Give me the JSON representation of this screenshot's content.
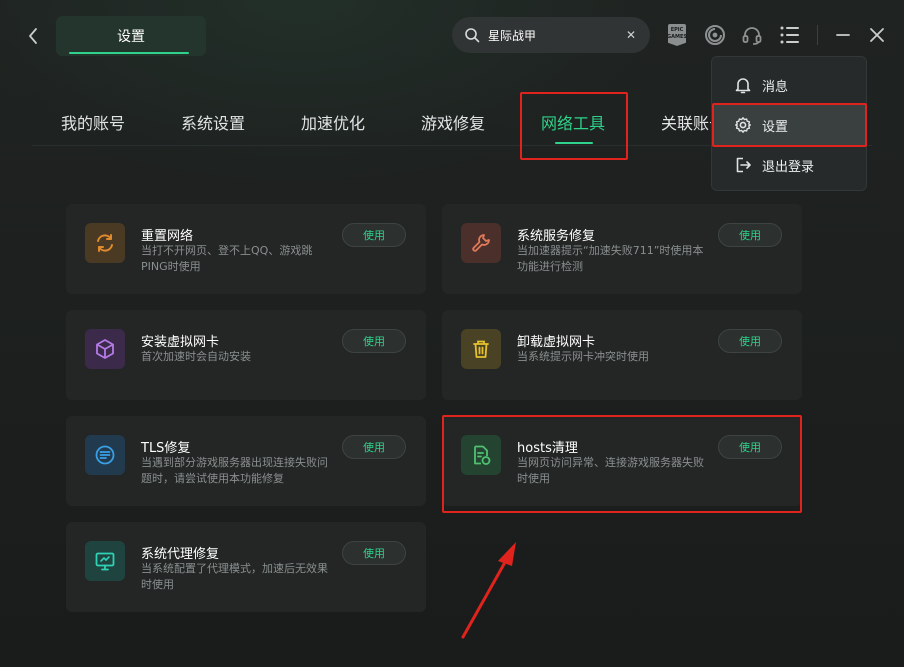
{
  "header": {
    "title": "设置",
    "search_value": "星际战甲",
    "epic_logo": "EPIC\nGAMES"
  },
  "nav": {
    "tabs": [
      {
        "label": "我的账号"
      },
      {
        "label": "系统设置"
      },
      {
        "label": "加速优化"
      },
      {
        "label": "游戏修复"
      },
      {
        "label": "网络工具"
      },
      {
        "label": "关联账号"
      }
    ],
    "active": "网络工具"
  },
  "cards": [
    {
      "title": "重置网络",
      "desc": "当打不开网页、登不上QQ、游戏跳PING时使用",
      "button": "使用",
      "icon": "refresh-icon",
      "color": "#e08a2e",
      "bg": "#4a3a24"
    },
    {
      "title": "系统服务修复",
      "desc": "当加速器提示“加速失败711”时使用本功能进行检测",
      "button": "使用",
      "icon": "wrench-icon",
      "color": "#e07a5a",
      "bg": "#4b2f2a"
    },
    {
      "title": "安装虚拟网卡",
      "desc": "首次加速时会自动安装",
      "button": "使用",
      "icon": "cube-icon",
      "color": "#b57ae6",
      "bg": "#3c2a4b"
    },
    {
      "title": "卸载虚拟网卡",
      "desc": "当系统提示网卡冲突时使用",
      "button": "使用",
      "icon": "trash-icon",
      "color": "#e6c12e",
      "bg": "#4a4224"
    },
    {
      "title": "TLS修复",
      "desc": "当遇到部分游戏服务器出现连接失败问题时，请尝试使用本功能修复",
      "button": "使用",
      "icon": "tls-icon",
      "color": "#3aa0e6",
      "bg": "#213a4e"
    },
    {
      "title": "hosts清理",
      "desc": "当网页访问异常、连接游戏服务器失败时使用",
      "button": "使用",
      "icon": "hosts-file-icon",
      "color": "#4ec272",
      "bg": "#244330"
    },
    {
      "title": "系统代理修复",
      "desc": "当系统配置了代理模式，加速后无效果时使用",
      "button": "使用",
      "icon": "monitor-icon",
      "color": "#2fd2b4",
      "bg": "#1f4440"
    }
  ],
  "dropdown": {
    "items": [
      {
        "label": "消息",
        "icon": "bell-icon"
      },
      {
        "label": "设置",
        "icon": "gear-icon"
      },
      {
        "label": "退出登录",
        "icon": "logout-icon"
      }
    ]
  },
  "colors": {
    "accent": "#2fd28a",
    "highlight": "#e0231c",
    "background": "#1b1d1d",
    "card": "#232625"
  }
}
